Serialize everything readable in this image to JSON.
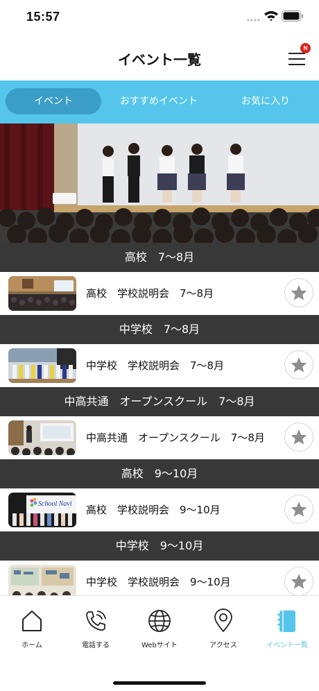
{
  "status_bar": {
    "time": "15:57"
  },
  "header": {
    "title": "イベント一覧",
    "badge": "N"
  },
  "tabs": [
    {
      "label": "イベント",
      "active": true
    },
    {
      "label": "おすすめイベント",
      "active": false
    },
    {
      "label": "お気に入り",
      "active": false
    }
  ],
  "events": [
    {
      "section": "高校　7〜8月",
      "title": "高校　学校説明会　7〜8月"
    },
    {
      "section": "中学校　7〜8月",
      "title": "中学校　学校説明会　7〜8月"
    },
    {
      "section": "中高共通　オープンスクール　7〜8月",
      "title": "中高共通　オープンスクール　7〜8月"
    },
    {
      "section": "高校　9〜10月",
      "title": "高校　学校説明会　9〜10月",
      "thumb_text": "School Navi"
    },
    {
      "section": "中学校　9〜10月",
      "title": "中学校　学校説明会　9〜10月"
    }
  ],
  "bottom_nav": [
    {
      "label": "ホーム",
      "icon": "home-icon"
    },
    {
      "label": "電話する",
      "icon": "phone-icon"
    },
    {
      "label": "Webサイト",
      "icon": "globe-icon"
    },
    {
      "label": "アクセス",
      "icon": "location-pin-icon"
    },
    {
      "label": "イベント一覧",
      "icon": "notebook-icon",
      "active": true
    }
  ],
  "colors": {
    "accent": "#55c5ec",
    "active_tab": "#3b9ec6",
    "section_bg": "#383838",
    "badge": "#d9241b"
  }
}
